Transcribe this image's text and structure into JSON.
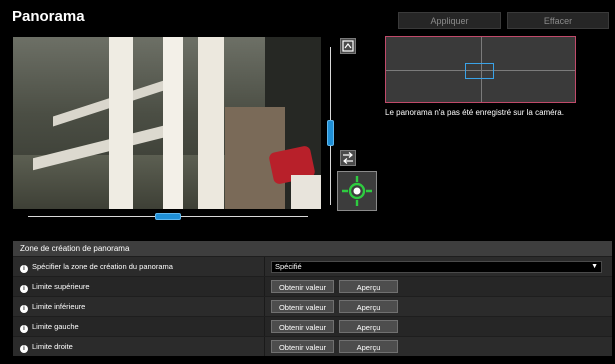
{
  "header": {
    "title": "Panorama",
    "apply_label": "Appliquer",
    "clear_label": "Effacer"
  },
  "panorama": {
    "status_text": "Le panorama n'a pas été enregistré sur la caméra."
  },
  "controls": {
    "zoom_level": 0.45,
    "pan_position": 0.5
  },
  "settings": {
    "section_title": "Zone de création de panorama",
    "zone_label": "Spécifier la zone de création du panorama",
    "zone_value": "Spécifié",
    "limits": [
      {
        "label": "Limite supérieure",
        "get_value_label": "Obtenir valeur",
        "preview_label": "Aperçu"
      },
      {
        "label": "Limite inférieure",
        "get_value_label": "Obtenir valeur",
        "preview_label": "Aperçu"
      },
      {
        "label": "Limite gauche",
        "get_value_label": "Obtenir valeur",
        "preview_label": "Aperçu"
      },
      {
        "label": "Limite droite",
        "get_value_label": "Obtenir valeur",
        "preview_label": "Aperçu"
      }
    ]
  },
  "colors": {
    "accent": "#1f8fd6",
    "target": "#2ecc40",
    "pano_border": "#c04a6a"
  }
}
